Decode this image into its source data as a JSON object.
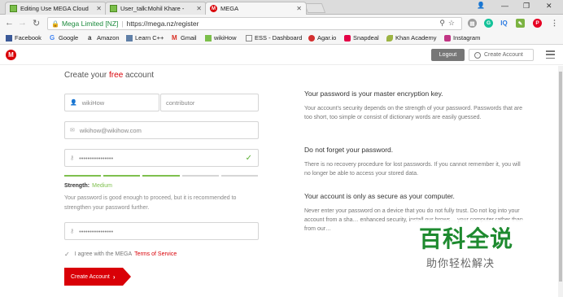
{
  "browser": {
    "tabs": [
      {
        "title": "Editing Use MEGA Cloud",
        "icon": "wikihow-icon"
      },
      {
        "title": "User_talk:Mohil Khare -",
        "icon": "wikihow-icon"
      },
      {
        "title": "MEGA",
        "icon": "mega-icon",
        "active": true
      }
    ],
    "address": {
      "secure_label": "Mega Limited [NZ]",
      "url": "https://mega.nz/register"
    },
    "bookmarks": [
      "Facebook",
      "Google",
      "Amazon",
      "Learn C++",
      "Gmail",
      "wikiHow",
      "ESS - Dashboard",
      "Agar.io",
      "Snapdeal",
      "Khan Academy",
      "Instagram"
    ]
  },
  "header": {
    "logo": "M",
    "logout_label": "Logout",
    "create_account_label": "Create Account"
  },
  "form": {
    "title_prefix": "Create your",
    "title_free": "free",
    "title_suffix": "account",
    "first_name": "wikiHow",
    "last_name": "contributor",
    "email": "wikihow@wikihow.com",
    "password": "••••••••••••••••",
    "confirm_password": "••••••••••••••••",
    "strength_label": "Strength:",
    "strength_value": "Medium",
    "strength_msg": "Your password is good enough to proceed, but it is recommended to strengthen your password further.",
    "agree_text": "I agree with the MEGA",
    "tos_link": "Terms of Service",
    "submit_label": "Create Account"
  },
  "info": [
    {
      "heading": "Your password is your master encryption key.",
      "text": "Your account's security depends on the strength of your password. Passwords that are too short, too simple or consist of dictionary words are easily guessed."
    },
    {
      "heading": "Do not forget your password.",
      "text": "There is no recovery procedure for lost passwords. If you cannot remember it, you will no longer be able to access your stored data."
    },
    {
      "heading": "Your account is only as secure as your computer.",
      "text": "Never enter your password on a device that you do not fully trust. Do not log into your account from a sha… enhanced security, install our brows… your computer rather than from our…"
    }
  ],
  "watermark": {
    "main": "百科全说",
    "sub": "助你轻松解决"
  },
  "colors": {
    "brand": "#d90007",
    "strength": "#7fc04e",
    "watermark": "#1e8a2f"
  }
}
